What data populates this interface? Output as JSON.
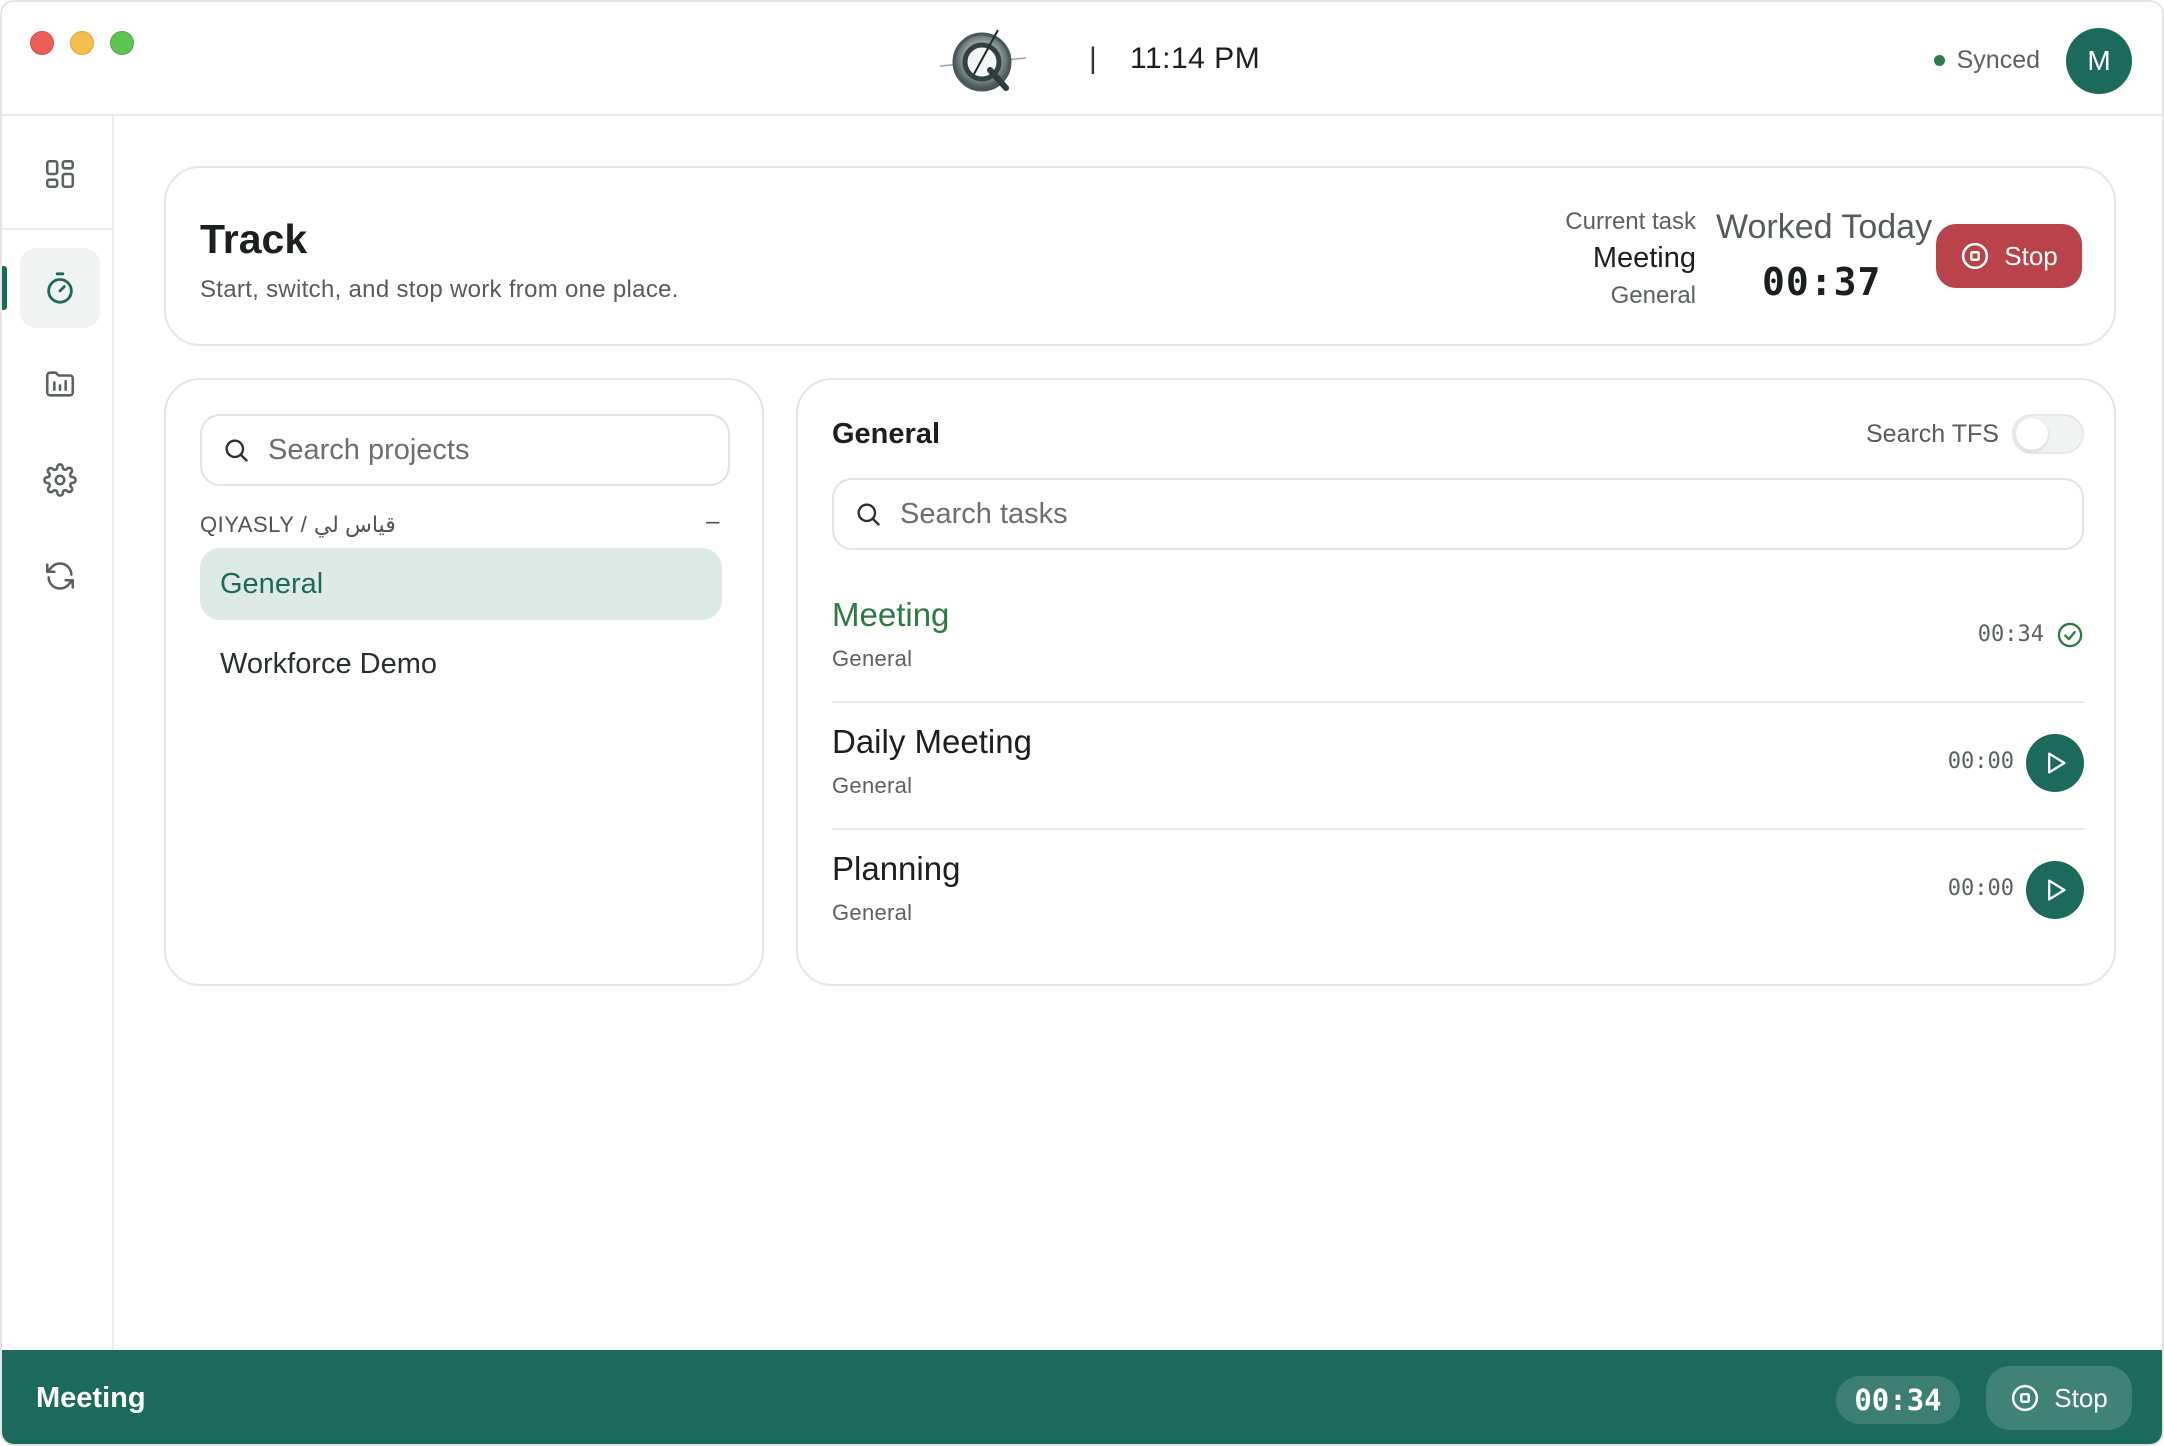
{
  "titlebar": {
    "separator": "|",
    "time": "11:14 PM",
    "sync_status": "Synced",
    "avatar_initial": "M"
  },
  "sidebar": {
    "items": [
      {
        "icon": "grid-icon",
        "name": "dashboard"
      },
      {
        "icon": "timer-icon",
        "name": "track",
        "active": true
      },
      {
        "icon": "folder-chart-icon",
        "name": "projects"
      },
      {
        "icon": "gear-icon",
        "name": "settings"
      },
      {
        "icon": "sync-icon",
        "name": "sync"
      }
    ]
  },
  "header": {
    "title": "Track",
    "subtitle": "Start, switch, and stop work from one place.",
    "current_task_label": "Current task",
    "current_task": "Meeting",
    "current_project": "General",
    "worked_today_label": "Worked Today",
    "worked_today": "00:37",
    "stop_label": "Stop"
  },
  "projects": {
    "search_placeholder": "Search projects",
    "group_label": "QIYASLY / قياس لي",
    "group_toggle": "–",
    "items": [
      "General",
      "Workforce Demo"
    ],
    "selected": "General"
  },
  "tasks": {
    "title": "General",
    "tfs_label": "Search TFS",
    "tfs_enabled": false,
    "search_placeholder": "Search tasks",
    "items": [
      {
        "name": "Meeting",
        "project": "General",
        "time": "00:34",
        "active": true
      },
      {
        "name": "Daily Meeting",
        "project": "General",
        "time": "00:00",
        "active": false
      },
      {
        "name": "Planning",
        "project": "General",
        "time": "00:00",
        "active": false
      }
    ]
  },
  "bottom_bar": {
    "task": "Meeting",
    "time": "00:34",
    "stop_label": "Stop"
  },
  "colors": {
    "accent": "#1c6a5b",
    "stop": "#b8434a",
    "active_task": "#2f7a42",
    "selected_bg": "#deeae6"
  }
}
